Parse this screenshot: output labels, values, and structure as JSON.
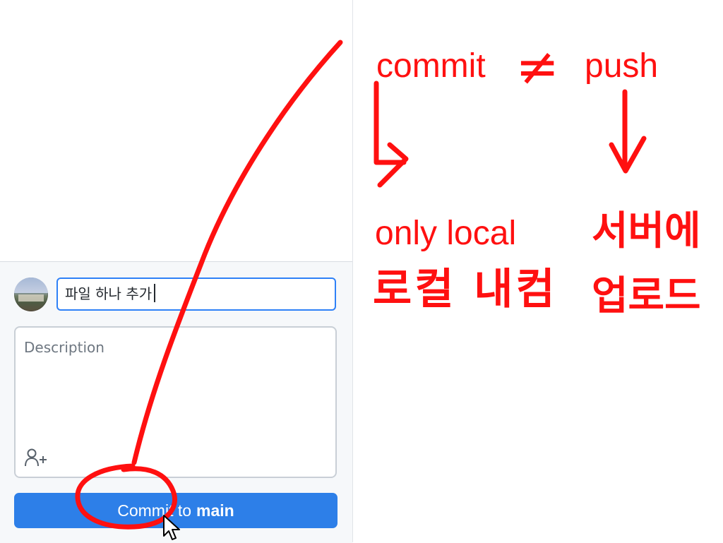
{
  "commit_panel": {
    "summary_value": "파일 하나 추가",
    "description_placeholder": "Description",
    "commit_button_prefix": "Commit to",
    "commit_button_branch": "main"
  },
  "annotations": {
    "commit_label": "commit",
    "not_equal": "≠",
    "push_label": "push",
    "commit_meaning": "only local",
    "commit_meaning_ko": "로컬 내컴",
    "push_meaning_ko": "서버에 업로드"
  },
  "colors": {
    "accent": "#2d7fe8",
    "focus_border": "#2f81f7",
    "annotation_red": "#ff1010"
  },
  "icons": {
    "coauthor": "person-plus-icon",
    "cursor": "mouse-pointer-icon"
  }
}
